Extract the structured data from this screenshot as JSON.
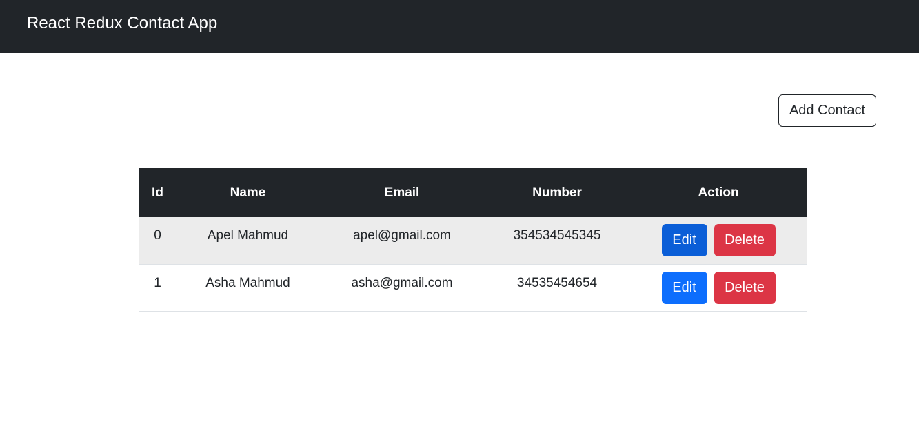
{
  "navbar": {
    "brand": "React Redux Contact App"
  },
  "toolbar": {
    "add_contact_label": "Add Contact"
  },
  "table": {
    "headers": {
      "id": "Id",
      "name": "Name",
      "email": "Email",
      "number": "Number",
      "action": "Action"
    },
    "rows": [
      {
        "id": "0",
        "name": "Apel Mahmud",
        "email": "apel@gmail.com",
        "number": "354534545345",
        "edit_label": "Edit",
        "delete_label": "Delete"
      },
      {
        "id": "1",
        "name": "Asha Mahmud",
        "email": "asha@gmail.com",
        "number": "34535454654",
        "edit_label": "Edit",
        "delete_label": "Delete"
      }
    ]
  },
  "colors": {
    "navbar_bg": "#212529",
    "primary": "#0d6efd",
    "primary_active": "#0b5ed7",
    "danger": "#dc3545",
    "striped_row": "#ececec"
  }
}
